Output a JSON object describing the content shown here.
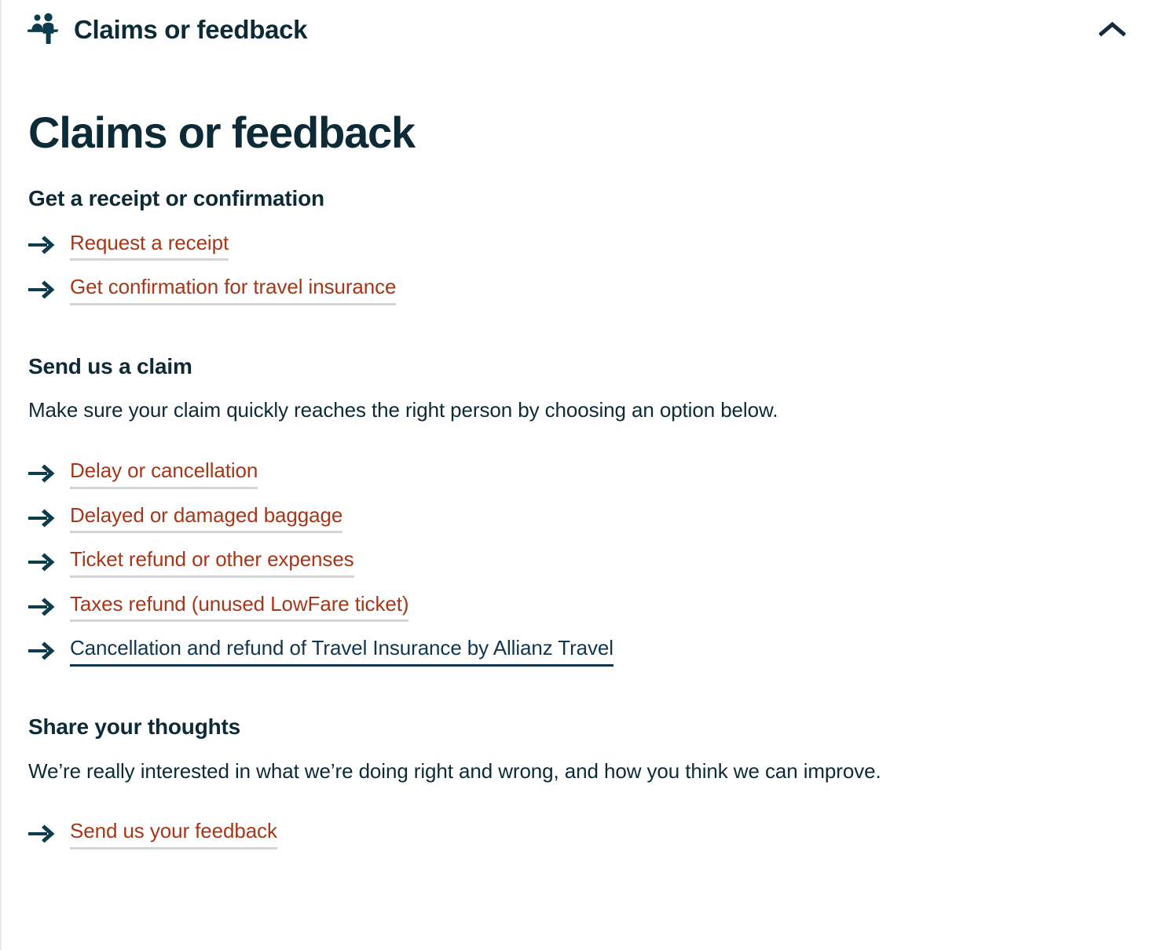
{
  "accordion": {
    "title": "Claims or feedback",
    "icon": "service-desk-icon",
    "toggle_icon": "chevron-up-icon",
    "expanded": true
  },
  "colors": {
    "heading": "#0d2b36",
    "link_red": "#a83618",
    "link_dark": "#103652",
    "underline_gray": "#d3d5d7",
    "icon_teal": "#0d3d4d"
  },
  "main": {
    "page_title": "Claims or feedback",
    "sections": [
      {
        "heading": "Get a receipt or confirmation",
        "text": "",
        "links": [
          {
            "label": "Request a receipt",
            "style": "red",
            "icon": "arrow-right-icon"
          },
          {
            "label": "Get confirmation for travel insurance",
            "style": "red",
            "icon": "arrow-right-icon"
          }
        ]
      },
      {
        "heading": "Send us a claim",
        "text": "Make sure your claim quickly reaches the right person by choosing an option below.",
        "links": [
          {
            "label": "Delay or cancellation",
            "style": "red",
            "icon": "arrow-right-icon"
          },
          {
            "label": "Delayed or damaged baggage",
            "style": "red",
            "icon": "arrow-right-icon"
          },
          {
            "label": "Ticket refund or other expenses",
            "style": "red",
            "icon": "arrow-right-icon"
          },
          {
            "label": "Taxes refund (unused LowFare ticket)",
            "style": "red",
            "icon": "arrow-right-icon"
          },
          {
            "label": "Cancellation and refund of Travel Insurance by Allianz Travel",
            "style": "dark",
            "icon": "arrow-right-icon"
          }
        ]
      },
      {
        "heading": "Share your thoughts",
        "text": "We’re really interested in what we’re doing right and wrong, and how you think we can improve.",
        "links": [
          {
            "label": "Send us your feedback",
            "style": "red",
            "icon": "arrow-right-icon"
          }
        ]
      }
    ]
  }
}
